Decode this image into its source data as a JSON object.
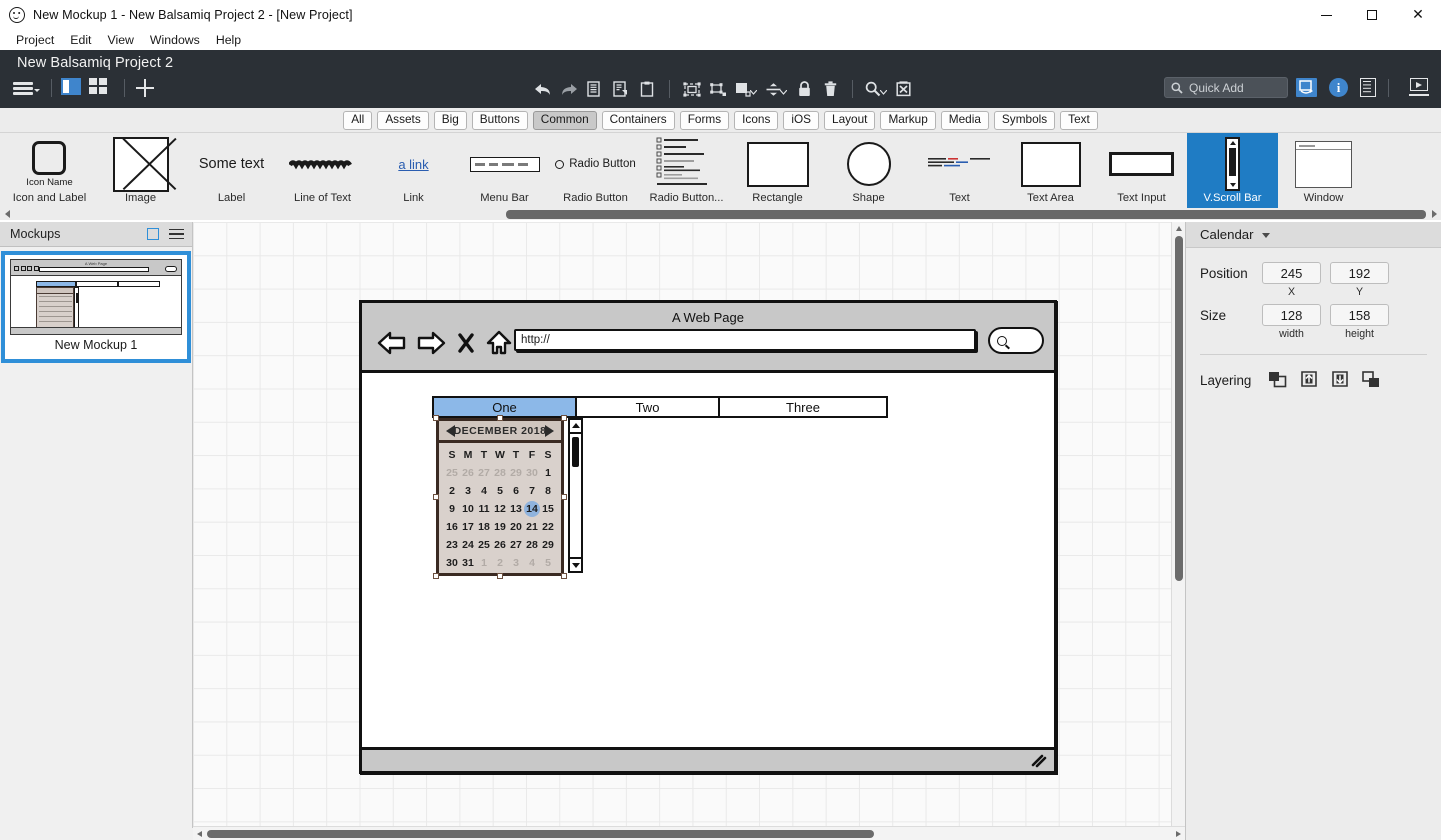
{
  "window": {
    "title": "New Mockup 1 - New Balsamiq Project 2 - [New Project]",
    "app_icon": "smiley-icon",
    "minimize": "minimize-icon",
    "maximize": "maximize-icon",
    "close": "close-icon"
  },
  "menubar": {
    "items": [
      {
        "label": "Project"
      },
      {
        "label": "Edit"
      },
      {
        "label": "View"
      },
      {
        "label": "Windows"
      },
      {
        "label": "Help"
      }
    ]
  },
  "appheader": {
    "project_title": "New Balsamiq Project 2",
    "background": "#2b3036",
    "left_tools": [
      {
        "name": "hamburger-menu-icon"
      },
      {
        "name": "panel-layout-icon",
        "active": true
      },
      {
        "name": "grid-layout-icon"
      },
      {
        "name": "add-mockup-icon"
      }
    ],
    "center_tools": [
      {
        "name": "undo-icon"
      },
      {
        "name": "redo-icon"
      },
      {
        "name": "copy-icon"
      },
      {
        "name": "duplicate-icon"
      },
      {
        "name": "paste-icon"
      },
      {
        "name": "group-icon"
      },
      {
        "name": "ungroup-icon"
      },
      {
        "name": "align-icon"
      },
      {
        "name": "distribute-icon"
      },
      {
        "name": "lock-icon"
      },
      {
        "name": "delete-icon"
      },
      {
        "name": "zoom-icon"
      },
      {
        "name": "fit-icon"
      }
    ],
    "quick_add": {
      "placeholder": "Quick Add",
      "icon": "search-icon"
    },
    "right_tools": [
      {
        "name": "ui-library-icon",
        "accent": "#3f85cc"
      },
      {
        "name": "info-icon",
        "glyph": "i",
        "accent": "#3f85cc"
      },
      {
        "name": "notes-icon"
      },
      {
        "name": "present-icon"
      }
    ]
  },
  "categories": {
    "active": "Common",
    "items": [
      {
        "label": "All"
      },
      {
        "label": "Assets"
      },
      {
        "label": "Big"
      },
      {
        "label": "Buttons"
      },
      {
        "label": "Common"
      },
      {
        "label": "Containers"
      },
      {
        "label": "Forms"
      },
      {
        "label": "Icons"
      },
      {
        "label": "iOS"
      },
      {
        "label": "Layout"
      },
      {
        "label": "Markup"
      },
      {
        "label": "Media"
      },
      {
        "label": "Symbols"
      },
      {
        "label": "Text"
      }
    ]
  },
  "palette": {
    "selected": "V.Scroll Bar",
    "items": [
      {
        "label": "Icon and Label",
        "thumb": "icon-and-label-thumb",
        "caption": "Icon Name"
      },
      {
        "label": "Image",
        "thumb": "image-thumb"
      },
      {
        "label": "Label",
        "thumb": "label-thumb",
        "caption": "Some text"
      },
      {
        "label": "Line of Text",
        "thumb": "line-of-text-thumb"
      },
      {
        "label": "Link",
        "thumb": "link-thumb",
        "caption": "a link"
      },
      {
        "label": "Menu Bar",
        "thumb": "menu-bar-thumb"
      },
      {
        "label": "Radio Button",
        "thumb": "radio-button-thumb",
        "caption": "Radio Button"
      },
      {
        "label": "Radio Button...",
        "thumb": "radio-button-group-thumb"
      },
      {
        "label": "Rectangle",
        "thumb": "rectangle-thumb"
      },
      {
        "label": "Shape",
        "thumb": "shape-thumb"
      },
      {
        "label": "Text",
        "thumb": "text-thumb"
      },
      {
        "label": "Text Area",
        "thumb": "text-area-thumb"
      },
      {
        "label": "Text Input",
        "thumb": "text-input-thumb"
      },
      {
        "label": "V.Scroll Bar",
        "thumb": "vscroll-bar-thumb"
      },
      {
        "label": "Window",
        "thumb": "window-thumb"
      }
    ]
  },
  "sidebar": {
    "title": "Mockups",
    "new_icon": "new-mockup-icon",
    "menu_icon": "sidebar-menu-icon",
    "mockups": [
      {
        "name": "New Mockup 1",
        "selected": true
      }
    ]
  },
  "canvas": {
    "browser": {
      "title": "A Web Page",
      "url_value": "http://",
      "nav": [
        {
          "name": "back-icon"
        },
        {
          "name": "forward-icon"
        },
        {
          "name": "stop-icon"
        },
        {
          "name": "home-icon"
        }
      ],
      "go_button": "search-go-icon"
    },
    "tabs": {
      "active": "One",
      "items": [
        {
          "label": "One"
        },
        {
          "label": "Two"
        },
        {
          "label": "Three"
        }
      ]
    },
    "calendar": {
      "month": "DECEMBER 2018",
      "prev_icon": "prev-month-icon",
      "next_icon": "next-month-icon",
      "day_headers": [
        "S",
        "M",
        "T",
        "W",
        "T",
        "F",
        "S"
      ],
      "selected_day": 14,
      "weeks": [
        [
          {
            "d": "25",
            "mute": true
          },
          {
            "d": "26",
            "mute": true
          },
          {
            "d": "27",
            "mute": true
          },
          {
            "d": "28",
            "mute": true
          },
          {
            "d": "29",
            "mute": true
          },
          {
            "d": "30",
            "mute": true
          },
          {
            "d": "1"
          }
        ],
        [
          {
            "d": "2"
          },
          {
            "d": "3"
          },
          {
            "d": "4"
          },
          {
            "d": "5"
          },
          {
            "d": "6"
          },
          {
            "d": "7"
          },
          {
            "d": "8"
          }
        ],
        [
          {
            "d": "9"
          },
          {
            "d": "10"
          },
          {
            "d": "11"
          },
          {
            "d": "12"
          },
          {
            "d": "13"
          },
          {
            "d": "14",
            "sel": true
          },
          {
            "d": "15"
          }
        ],
        [
          {
            "d": "16"
          },
          {
            "d": "17"
          },
          {
            "d": "18"
          },
          {
            "d": "19"
          },
          {
            "d": "20"
          },
          {
            "d": "21"
          },
          {
            "d": "22"
          }
        ],
        [
          {
            "d": "23"
          },
          {
            "d": "24"
          },
          {
            "d": "25"
          },
          {
            "d": "26"
          },
          {
            "d": "27"
          },
          {
            "d": "28"
          },
          {
            "d": "29"
          }
        ],
        [
          {
            "d": "30"
          },
          {
            "d": "31"
          },
          {
            "d": "1",
            "mute": true
          },
          {
            "d": "2",
            "mute": true
          },
          {
            "d": "3",
            "mute": true
          },
          {
            "d": "4",
            "mute": true
          },
          {
            "d": "5",
            "mute": true
          }
        ]
      ]
    },
    "scrollbar_widget": "vertical-scrollbar-widget"
  },
  "inspector": {
    "title": "Calendar",
    "position_label": "Position",
    "position_x": "245",
    "position_y": "192",
    "x_caption": "X",
    "y_caption": "Y",
    "size_label": "Size",
    "width": "128",
    "height": "158",
    "width_caption": "width",
    "height_caption": "height",
    "layering_label": "Layering",
    "layering_buttons": [
      {
        "name": "bring-to-front-icon"
      },
      {
        "name": "bring-forward-icon"
      },
      {
        "name": "send-backward-icon"
      },
      {
        "name": "send-to-back-icon"
      }
    ]
  }
}
